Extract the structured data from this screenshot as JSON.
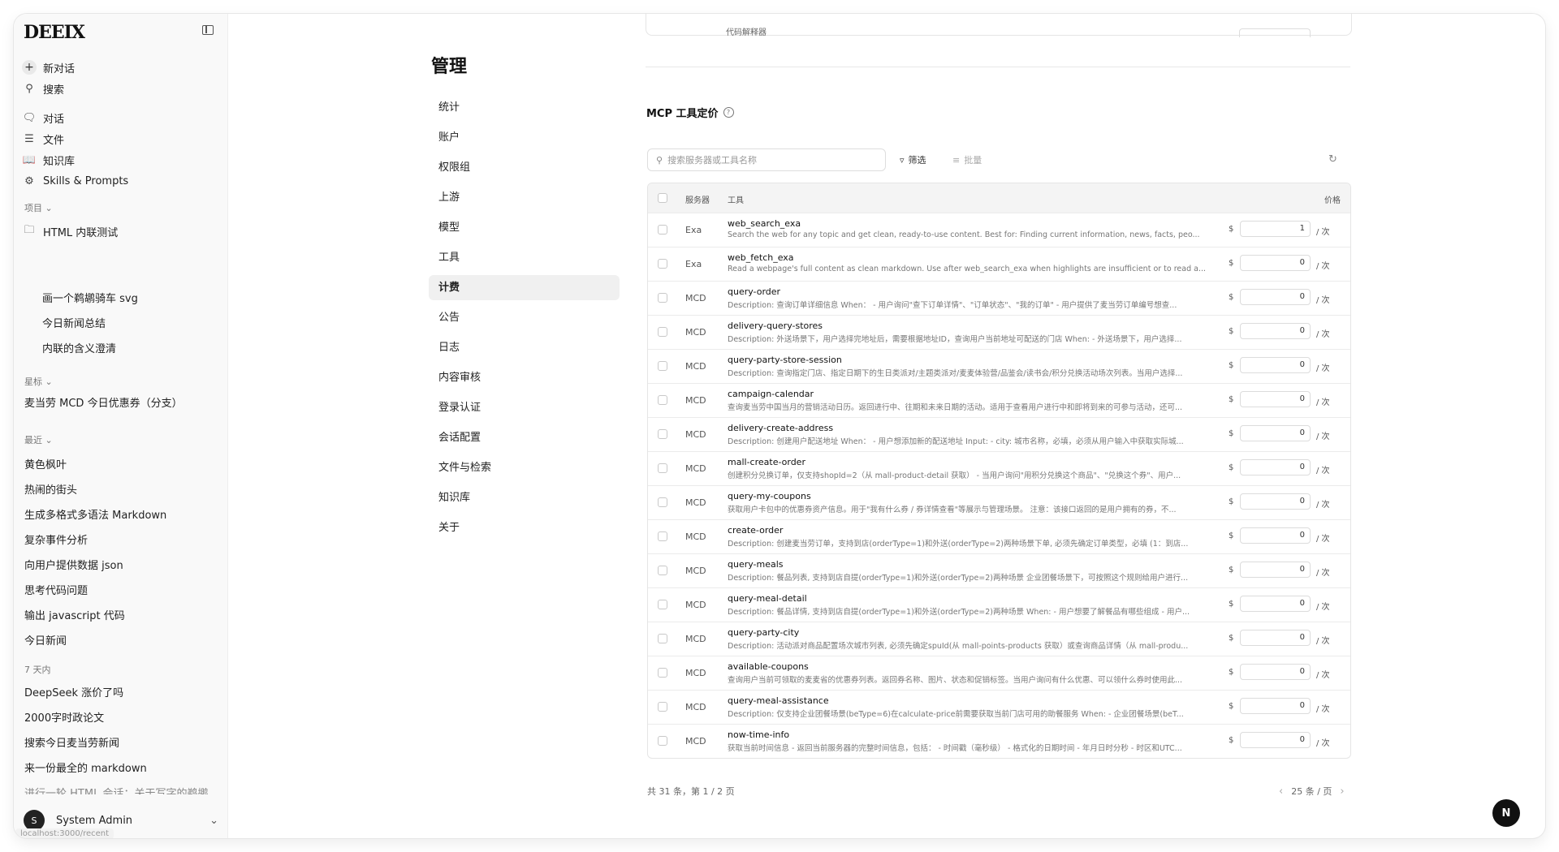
{
  "sidebar": {
    "logo": "DEEIX",
    "new_chat": "新对话",
    "search": "搜索",
    "nav": [
      "对话",
      "文件",
      "知识库",
      "Skills & Prompts"
    ],
    "projects_label": "项目",
    "projects": [
      {
        "label": "HTML 内联测试",
        "sub": false
      },
      {
        "label": "画一个鹈鹕骑车 svg",
        "sub": true
      },
      {
        "label": "今日新闻总结",
        "sub": true
      },
      {
        "label": "内联的含义澄清",
        "sub": true
      }
    ],
    "starred_label": "星标",
    "starred": [
      "麦当劳 MCD 今日优惠券（分支）"
    ],
    "recent_label": "最近",
    "recent": [
      "黄色枫叶",
      "热闹的街头",
      "生成多格式多语法 Markdown",
      "复杂事件分析",
      "向用户提供数据 json",
      "思考代码问题",
      "输出 javascript 代码",
      "今日新闻"
    ],
    "week_label": "7 天内",
    "week": [
      "DeepSeek 涨价了吗",
      "2000字时政论文",
      "搜索今日麦当劳新闻",
      "来一份最全的 markdown",
      "进行一轮 HTML 会话：关于写字的鹈鹕"
    ],
    "user_initial": "S",
    "user_name": "System Admin",
    "status_url": "localhost:3000/recent"
  },
  "admin": {
    "title": "管理",
    "nav": [
      "统计",
      "账户",
      "权限组",
      "上游",
      "模型",
      "工具",
      "计费",
      "公告",
      "日志",
      "内容审核",
      "登录认证",
      "会话配置",
      "文件与检索",
      "知识库",
      "关于"
    ],
    "active": "计费"
  },
  "main": {
    "top_cut_text": "代码解释器",
    "section_title": "MCP 工具定价",
    "search_placeholder": "搜索服务器或工具名称",
    "filter": "筛选",
    "batch": "批量",
    "headers": {
      "server": "服务器",
      "tool": "工具",
      "price": "价格"
    },
    "currency": "$",
    "unit": "/ 次",
    "rows": [
      {
        "server": "Exa",
        "name": "web_search_exa",
        "desc": "Search the web for any topic and get clean, ready-to-use content. Best for: Finding current information, news, facts, peo...",
        "price": "1"
      },
      {
        "server": "Exa",
        "name": "web_fetch_exa",
        "desc": "Read a webpage's full content as clean markdown. Use after web_search_exa when highlights are insufficient or to read a...",
        "price": "0"
      },
      {
        "server": "MCD",
        "name": "query-order",
        "desc": "Description: 查询订单详细信息 When： - 用户询问\"查下订单详情\"、\"订单状态\"、\"我的订单\" - 用户提供了麦当劳订单编号想查...",
        "price": "0"
      },
      {
        "server": "MCD",
        "name": "delivery-query-stores",
        "desc": "Description: 外送场景下，用户选择完地址后，需要根据地址ID，查询用户当前地址可配送的门店 When: - 外送场景下，用户选择...",
        "price": "0"
      },
      {
        "server": "MCD",
        "name": "query-party-store-session",
        "desc": "Description: 查询指定门店、指定日期下的生日类派对/主题类派对/麦麦体验营/品鉴会/读书会/积分兑换活动场次列表。当用户选择...",
        "price": "0"
      },
      {
        "server": "MCD",
        "name": "campaign-calendar",
        "desc": "查询麦当劳中国当月的营销活动日历。返回进行中、往期和未来日期的活动。适用于查看用户进行中和即将到来的可参与活动，还可...",
        "price": "0"
      },
      {
        "server": "MCD",
        "name": "delivery-create-address",
        "desc": "Description: 创建用户配送地址 When： - 用户想添加新的配送地址 Input: - city: 城市名称，必填，必须从用户输入中获取实际城...",
        "price": "0"
      },
      {
        "server": "MCD",
        "name": "mall-create-order",
        "desc": "创建积分兑换订单，仅支持shopId=2（从 mall-product-detail 获取） - 当用户询问\"用积分兑换这个商品\"、\"兑换这个券\"、用户...",
        "price": "0"
      },
      {
        "server": "MCD",
        "name": "query-my-coupons",
        "desc": "获取用户卡包中的优惠券资产信息。用于\"我有什么券 / 券详情查看\"等展示与管理场景。 注意：该接口返回的是用户拥有的券，不...",
        "price": "0"
      },
      {
        "server": "MCD",
        "name": "create-order",
        "desc": "Description: 创建麦当劳订单，支持到店(orderType=1)和外送(orderType=2)两种场景下单, 必须先确定订单类型，必填 (1：到店...",
        "price": "0"
      },
      {
        "server": "MCD",
        "name": "query-meals",
        "desc": "Description: 餐品列表, 支持到店自提(orderType=1)和外送(orderType=2)两种场景 企业团餐场景下，可按照这个规则给用户进行...",
        "price": "0"
      },
      {
        "server": "MCD",
        "name": "query-meal-detail",
        "desc": "Description: 餐品详情, 支持到店自提(orderType=1)和外送(orderType=2)两种场景 When: - 用户想要了解餐品有哪些组成 - 用户...",
        "price": "0"
      },
      {
        "server": "MCD",
        "name": "query-party-city",
        "desc": "Description: 活动派对商品配置场次城市列表, 必须先确定spuId(从 mall-points-products 获取）或查询商品详情（从 mall-produ...",
        "price": "0"
      },
      {
        "server": "MCD",
        "name": "available-coupons",
        "desc": "查询用户当前可领取的麦麦省的优惠券列表。返回券名称、图片、状态和促销标签。当用户询问有什么优惠、可以领什么券时使用此...",
        "price": "0"
      },
      {
        "server": "MCD",
        "name": "query-meal-assistance",
        "desc": "Description: 仅支持企业团餐场景(beType=6)在calculate-price前需要获取当前门店可用的助餐服务 When: - 企业团餐场景(beT...",
        "price": "0"
      },
      {
        "server": "MCD",
        "name": "now-time-info",
        "desc": "获取当前时间信息 - 返回当前服务器的完整时间信息，包括： - 时间戳（毫秒级） - 格式化的日期时间 - 年月日时分秒 - 时区和UTC...",
        "price": "0"
      }
    ],
    "pager_info": "共 31 条，第 1 / 2 页",
    "page_size": "25 条 / 页"
  },
  "floating_badge": "N"
}
